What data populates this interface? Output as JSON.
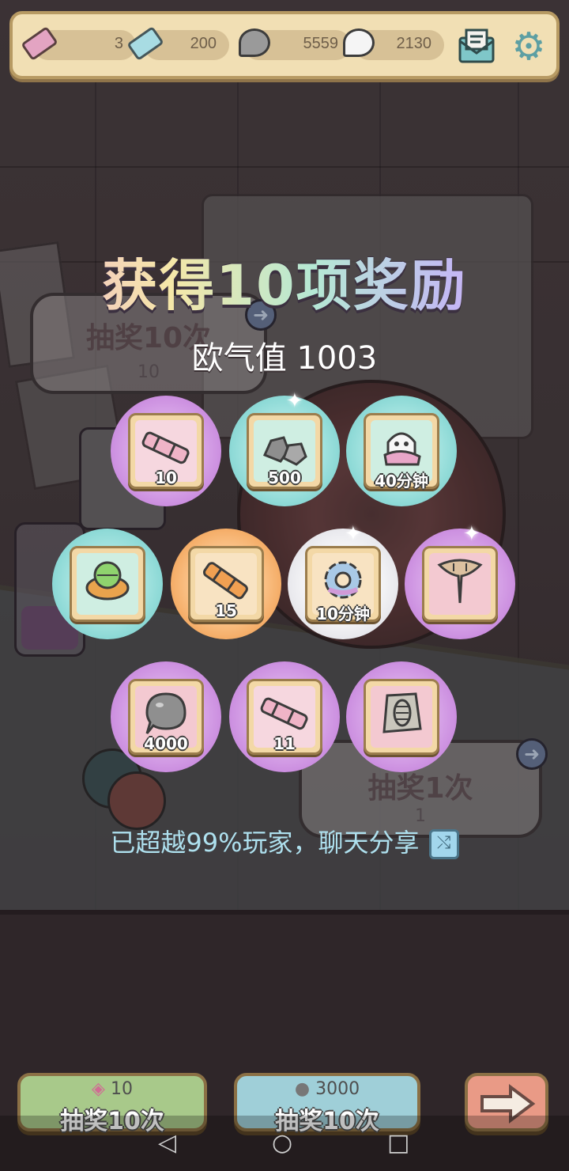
{
  "resources": [
    {
      "name": "pink-ticket",
      "value": "3"
    },
    {
      "name": "blue-ticket",
      "value": "200"
    },
    {
      "name": "soul",
      "value": "5559"
    },
    {
      "name": "ghost",
      "value": "2130"
    }
  ],
  "reward": {
    "title": "获得10项奖励",
    "luck_text": "欧气值 1003",
    "items": [
      {
        "name": "pink-telescope",
        "qty": "10",
        "bg": "purple"
      },
      {
        "name": "stones",
        "qty": "500",
        "bg": "teal"
      },
      {
        "name": "ghost-cloth",
        "qty": "40分钟",
        "bg": "teal"
      },
      {
        "name": "crystal-ring",
        "qty": "",
        "bg": "teal"
      },
      {
        "name": "orange-telescope",
        "qty": "15",
        "bg": "orange"
      },
      {
        "name": "gear",
        "qty": "10分钟",
        "bg": "white"
      },
      {
        "name": "bone-fossil",
        "qty": "",
        "bg": "purple"
      },
      {
        "name": "soul-blob",
        "qty": "4000",
        "bg": "purple"
      },
      {
        "name": "pink-telescope",
        "qty": "11",
        "bg": "purple"
      },
      {
        "name": "fossil-slab",
        "qty": "",
        "bg": "purple"
      }
    ],
    "share_text": "已超越99%玩家，聊天分享"
  },
  "background_panels": {
    "left": {
      "label": "抽奖10次",
      "cost": "10"
    },
    "right": {
      "label": "抽奖1次",
      "cost": "1"
    }
  },
  "buttons": [
    {
      "cost": "10",
      "label": "抽奖10次",
      "color": "#a8c98a"
    },
    {
      "cost": "3000",
      "label": "抽奖10次",
      "color": "#9fcfd8"
    }
  ],
  "colors": {
    "bar": "#f1dfb4",
    "title_gradient": [
      "#f3b2d5",
      "#f5e7a8",
      "#b5e8d4",
      "#c3b8f4"
    ]
  }
}
